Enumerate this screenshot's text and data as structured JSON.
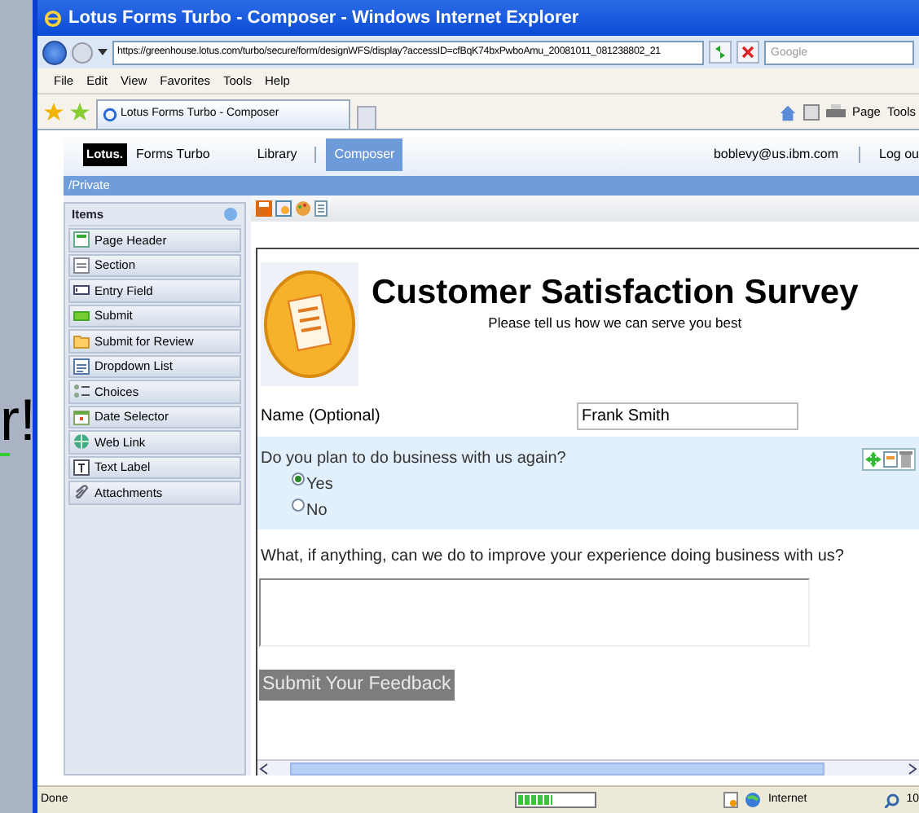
{
  "background_text": "r!",
  "window": {
    "title": "Lotus Forms Turbo - Composer - Windows Internet Explorer"
  },
  "address_bar": {
    "url": "https://greenhouse.lotus.com/turbo/secure/form/designWFS/display?accessID=cfBqK74bxPwboAmu_20081011_081238802_21"
  },
  "search": {
    "placeholder": "Google"
  },
  "menu": [
    "File",
    "Edit",
    "View",
    "Favorites",
    "Tools",
    "Help"
  ],
  "tab": {
    "label": "Lotus Forms Turbo - Composer"
  },
  "command_bar": [
    "Page",
    "Tools"
  ],
  "app_header": {
    "logo": "Lotus.",
    "product": "Forms Turbo",
    "nav": [
      {
        "label": "Library",
        "selected": false
      },
      {
        "label": "Composer",
        "selected": true
      }
    ],
    "user": "boblevy@us.ibm.com",
    "logout": "Log ou"
  },
  "breadcrumb": "/Private",
  "items_panel": {
    "title": "Items",
    "items": [
      "Page Header",
      "Section",
      "Entry Field",
      "Submit",
      "Submit for Review",
      "Dropdown List",
      "Choices",
      "Date Selector",
      "Web Link",
      "Text Label",
      "Attachments"
    ]
  },
  "form": {
    "title": "Customer Satisfaction Survey",
    "subtitle": "Please tell us how we can serve you best",
    "name_field": {
      "label": "Name (Optional)",
      "value": "Frank Smith"
    },
    "question": {
      "text": "Do you plan to do business with us again?",
      "options": [
        {
          "label": "Yes",
          "selected": true
        },
        {
          "label": "No",
          "selected": false
        }
      ]
    },
    "comment": {
      "label": "What, if anything, can we do to improve your experience doing business with us?"
    },
    "submit": "Submit Your Feedback"
  },
  "status_bar": {
    "text": "Done",
    "progress": {
      "level": 0.45
    },
    "zone": "Internet",
    "zoom": "10"
  }
}
